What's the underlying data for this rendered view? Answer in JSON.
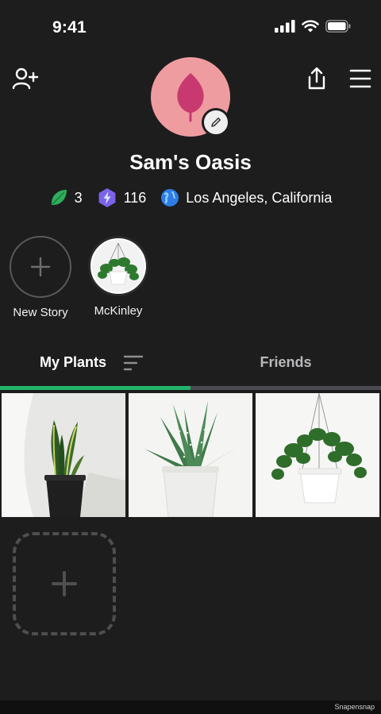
{
  "status_bar": {
    "time": "9:41"
  },
  "profile": {
    "name": "Sam's Oasis",
    "avatar_color": "#ef9ca0",
    "stats": [
      {
        "icon": "leaf-gem-icon",
        "value": "3",
        "color": "#2fae5b"
      },
      {
        "icon": "lightning-badge-icon",
        "value": "116",
        "color": "#7d62e8"
      },
      {
        "icon": "globe-icon",
        "value": "Los Angeles, California",
        "color": "#2e7de4"
      }
    ]
  },
  "stories": [
    {
      "label": "New Story",
      "icon": "plus-icon"
    },
    {
      "label": "McKinley",
      "icon": "plant-thumbnail"
    }
  ],
  "tabs": [
    {
      "label": "My Plants",
      "active": true
    },
    {
      "label": "Friends",
      "active": false
    }
  ],
  "accent_color": "#23b36a",
  "plants": [
    {
      "name": "snake-plant"
    },
    {
      "name": "aloe-plant"
    },
    {
      "name": "hanging-pilea"
    }
  ],
  "watermark": "Snapensnap"
}
